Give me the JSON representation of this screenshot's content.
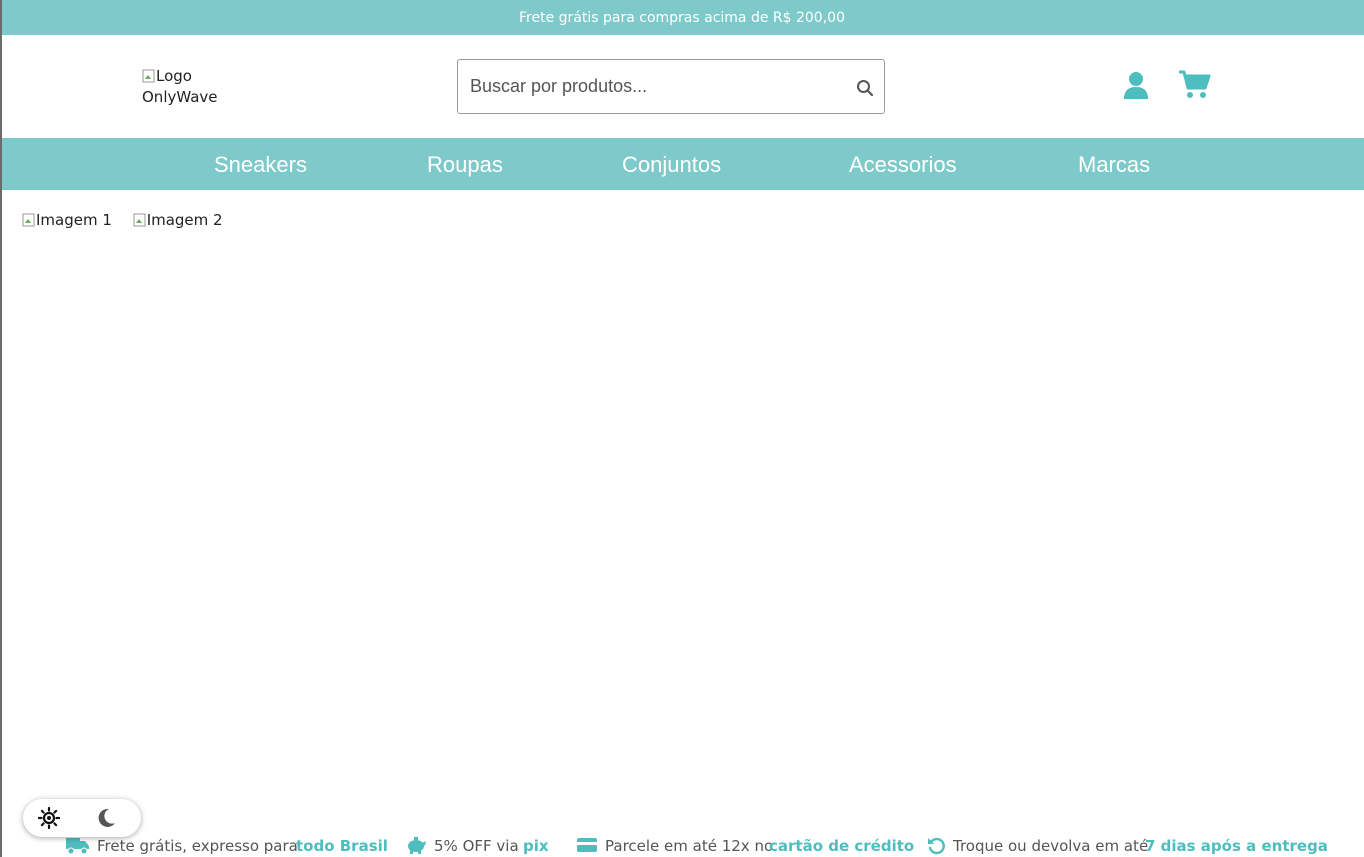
{
  "topbar": {
    "text": "Frete grátis para compras acima de R$ 200,00"
  },
  "header": {
    "logo_alt_line1": "Logo",
    "logo_alt_line2": "OnlyWave",
    "search_placeholder": "Buscar por produtos...",
    "search_icon": "search-icon",
    "user_icon": "user-icon",
    "cart_icon": "cart-icon"
  },
  "nav": {
    "items": [
      {
        "label": "Sneakers"
      },
      {
        "label": "Roupas"
      },
      {
        "label": "Conjuntos"
      },
      {
        "label": "Acessorios"
      },
      {
        "label": "Marcas"
      }
    ]
  },
  "main": {
    "images": [
      {
        "alt": "Imagem 1"
      },
      {
        "alt": "Imagem 2"
      }
    ]
  },
  "theme_toggle": {
    "light_icon": "sun-icon",
    "dark_icon": "moon-icon"
  },
  "benefits": [
    {
      "icon": "truck-icon",
      "text": "Frete grátis, expresso para",
      "highlight": "todo Brasil"
    },
    {
      "icon": "piggy-bank-icon",
      "text": "5% OFF via",
      "highlight": "pix"
    },
    {
      "icon": "credit-card-icon",
      "text": "Parcele em até 12x no",
      "highlight": "cartão de crédito"
    },
    {
      "icon": "return-icon",
      "text": "Troque ou devolva em até",
      "highlight": "7 dias após a entrega"
    }
  ],
  "colors": {
    "accent": "#7ecacb",
    "icon": "#4dbdbd",
    "highlight": "#4dbdbd"
  }
}
